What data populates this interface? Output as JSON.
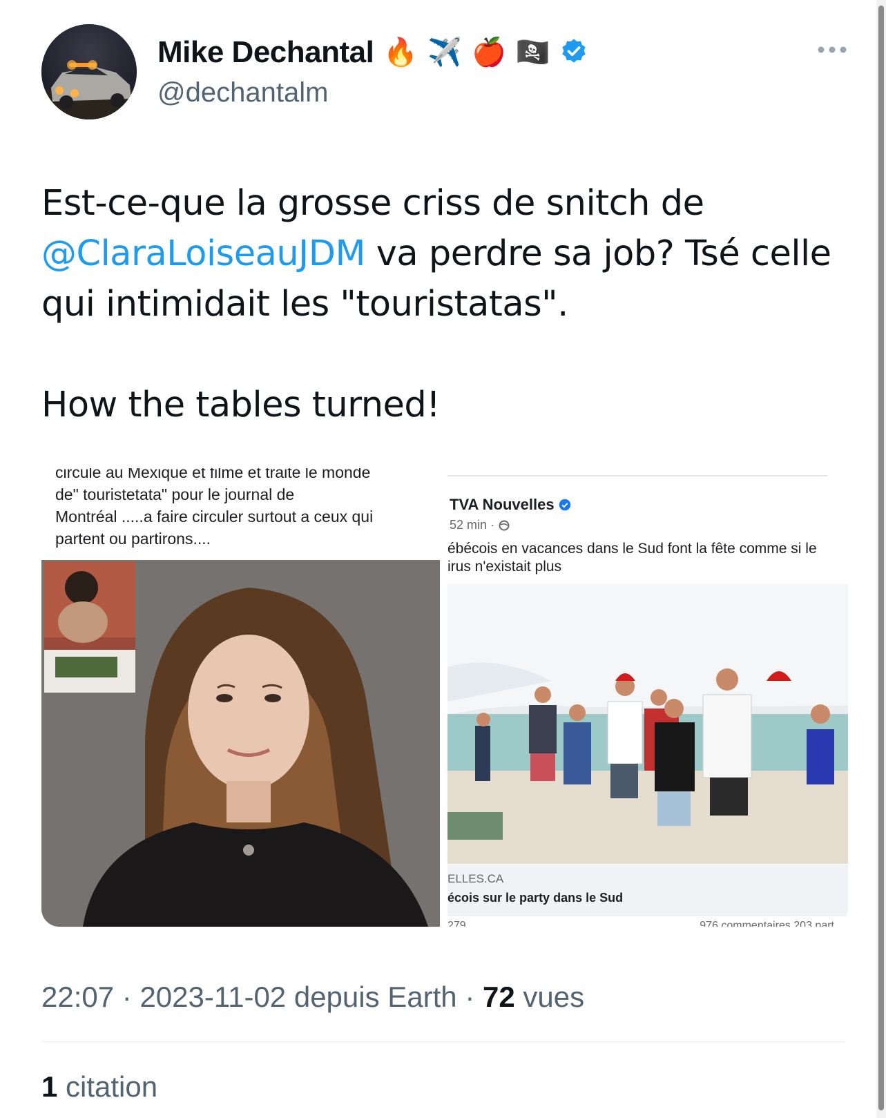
{
  "author": {
    "display_name": "Mike Dechantal",
    "handle": "@dechantalm",
    "emojis": [
      "🔥",
      "✈️",
      "🍎",
      "🏴‍☠️"
    ],
    "verified": true,
    "verified_color": "#1d9bf0"
  },
  "tweet": {
    "text_before_mention": "Est-ce-que la grosse criss de snitch de ",
    "mention": "@ClaraLoiseauJDM",
    "text_after_mention": " va perdre sa job? Tsé celle qui intimidait les \"touristatas\".",
    "text_second_paragraph": "How the tables turned!"
  },
  "media": {
    "left_caption_top": "circule au Mexique et filme  et traite le monde",
    "left_caption_lines": [
      "de\" touristetata\" pour le journal de",
      "Montréal .....a faire circuler  surtout a ceux qui",
      "partent ou partirons...."
    ],
    "fb_post": {
      "page_name": "TVA Nouvelles",
      "time": "52 min ·",
      "text_line1": "ébécois en vacances dans le Sud font la fête comme si le",
      "text_line2": "irus n'existait plus",
      "link_domain": "ELLES.CA",
      "link_title": "écois sur le party dans le Sud",
      "reactions": "279",
      "comments_shares": "976 commentaires  203 part"
    }
  },
  "meta": {
    "time": "22:07",
    "date": "2023-11-02",
    "source": "depuis Earth",
    "views_count": "72",
    "views_label": "vues"
  },
  "quotes": {
    "count": "1",
    "label": "citation"
  },
  "colors": {
    "accent": "#1d9bf0",
    "text_primary": "#0f1419",
    "text_secondary": "#536471"
  }
}
